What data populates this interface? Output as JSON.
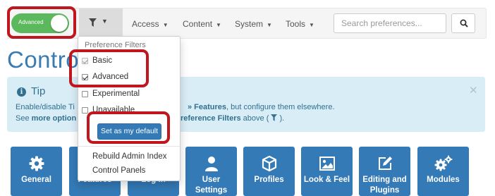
{
  "navbar": {
    "mode_toggle_label": "Advanced",
    "menus": [
      "Access",
      "Content",
      "System",
      "Tools"
    ],
    "search_placeholder": "Search preferences..."
  },
  "page_title": "Contro",
  "tip": {
    "title": "Tip",
    "line1_a": "Enable/disable Ti",
    "line1_b": "» Features",
    "line1_c": ", but configure them elsewhere.",
    "line2_a": "See ",
    "line2_b": "more option",
    "line2_c": "reference Filters",
    "line2_d": " above ( ",
    "line2_e": " )."
  },
  "dropdown": {
    "header": "Preference Filters",
    "filters": [
      {
        "label": "Basic",
        "checked": true,
        "disabled": true
      },
      {
        "label": "Advanced",
        "checked": true,
        "disabled": false
      },
      {
        "label": "Experimental",
        "checked": false,
        "disabled": false
      },
      {
        "label": "Unavailable",
        "checked": false,
        "disabled": false
      }
    ],
    "default_button": "Set as my default",
    "links": [
      "Rebuild Admin Index",
      "Control Panels"
    ]
  },
  "tiles": [
    {
      "label": "General",
      "icon": "gear-icon"
    },
    {
      "label": "Features",
      "icon": "features-icon"
    },
    {
      "label": "Log in",
      "icon": "login-icon"
    },
    {
      "label": "User Settings",
      "icon": "user-icon"
    },
    {
      "label": "Profiles",
      "icon": "cube-icon"
    },
    {
      "label": "Look & Feel",
      "icon": "image-icon"
    },
    {
      "label": "Editing and Plugins",
      "icon": "edit-icon"
    },
    {
      "label": "Modules",
      "icon": "cogs-icon"
    }
  ],
  "colors": {
    "primary": "#337ab7",
    "toggle_on": "#5cb85c",
    "title_blue": "#3a7cb2",
    "tip_bg": "#d9edf7",
    "highlight_red": "#c0161d"
  }
}
